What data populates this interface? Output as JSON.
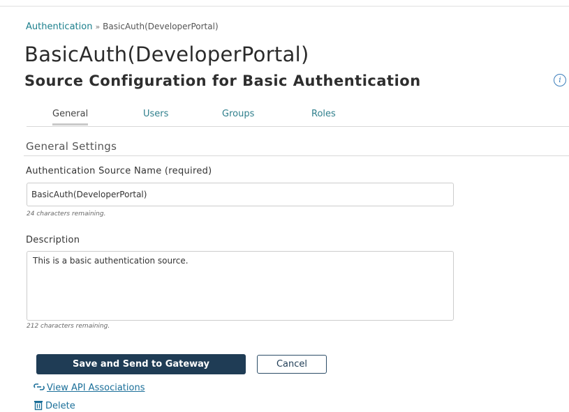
{
  "breadcrumb": {
    "parent": "Authentication",
    "separator": "»",
    "current": "BasicAuth(DeveloperPortal)"
  },
  "header": {
    "title": "BasicAuth(DeveloperPortal)",
    "subtitle": "Source Configuration for Basic Authentication",
    "info_icon": "info-icon"
  },
  "tabs": [
    {
      "label": "General",
      "active": true
    },
    {
      "label": "Users",
      "active": false
    },
    {
      "label": "Groups",
      "active": false
    },
    {
      "label": "Roles",
      "active": false
    }
  ],
  "section": {
    "heading": "General Settings"
  },
  "form": {
    "source_name": {
      "label": "Authentication Source Name  (required)",
      "value": "BasicAuth(DeveloperPortal)",
      "hint": "24 characters remaining."
    },
    "description": {
      "label": "Description",
      "value": "This is a basic authentication source.",
      "hint": "212 characters remaining."
    }
  },
  "actions": {
    "save_label": "Save and Send to Gateway",
    "cancel_label": "Cancel",
    "view_api_label": "View API Associations",
    "view_api_icon": "link-icon",
    "delete_label": "Delete",
    "delete_icon": "trash-icon"
  },
  "colors": {
    "primary_button": "#1f3c55",
    "link": "#1b7f8c",
    "action_link": "#1b6f99"
  }
}
